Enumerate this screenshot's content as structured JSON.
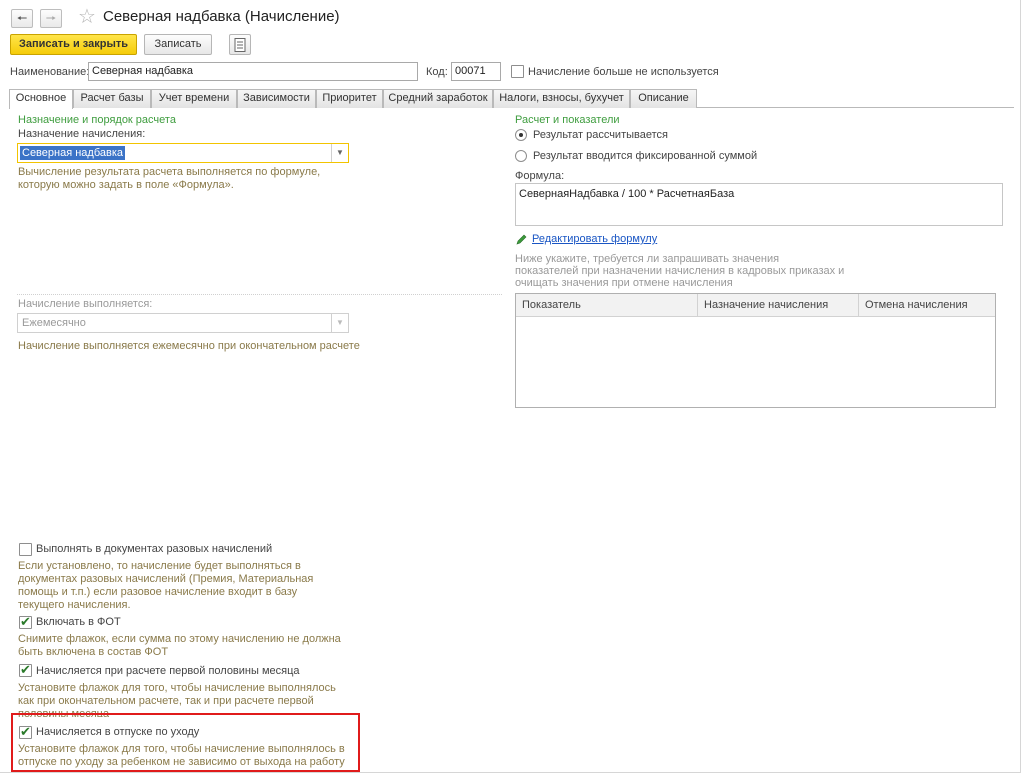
{
  "window": {
    "title": "Северная надбавка (Начисление)",
    "back_icon": "arrow-left-icon",
    "forward_icon": "arrow-right-icon",
    "favorite_icon": "star-icon"
  },
  "toolbar": {
    "save_close_label": "Записать и закрыть",
    "save_label": "Записать",
    "report_icon": "document-list-icon"
  },
  "header": {
    "name_label": "Наименование:",
    "name_value": "Северная надбавка",
    "code_label": "Код:",
    "code_value": "00071",
    "not_used_label": "Начисление больше не используется"
  },
  "tabs": [
    {
      "label": "Основное"
    },
    {
      "label": "Расчет базы"
    },
    {
      "label": "Учет времени"
    },
    {
      "label": "Зависимости"
    },
    {
      "label": "Приоритет"
    },
    {
      "label": "Средний заработок"
    },
    {
      "label": "Налоги, взносы, бухучет"
    },
    {
      "label": "Описание"
    }
  ],
  "left": {
    "section_title": "Назначение и порядок расчета",
    "purpose_label": "Назначение начисления:",
    "purpose_value": "Северная надбавка",
    "purpose_hint_1": "Вычисление результата расчета выполняется по формуле,",
    "purpose_hint_2": "которую можно задать в поле «Формула».",
    "period_label": "Начисление выполняется:",
    "period_value": "Ежемесячно",
    "period_hint": "Начисление выполняется ежемесячно при окончательном расчете",
    "one_time": {
      "label": "Выполнять в документах разовых начислений",
      "hint": [
        "Если установлено, то начисление будет выполняться в",
        "документах разовых начислений (Премия, Материальная",
        "помощь и т.п.) если разовое начисление входит в базу",
        "текущего начисления."
      ]
    },
    "fot": {
      "label": "Включать в ФОТ",
      "hint": [
        "Снимите флажок, если сумма по этому начислению не должна",
        "быть включена в состав ФОТ"
      ]
    },
    "first_half": {
      "label": "Начисляется при расчете первой половины месяца",
      "hint": [
        "Установите флажок для того, чтобы начисление выполнялось",
        "как при окончательном расчете, так и при расчете первой",
        "половины месяца"
      ]
    },
    "childcare": {
      "label": "Начисляется в отпуске по уходу",
      "hint": [
        "Установите флажок для того, чтобы начисление выполнялось в",
        "отпуске по уходу за ребенком не зависимо от выхода на работу"
      ]
    }
  },
  "right": {
    "section_title": "Расчет и показатели",
    "radio_calc": "Результат рассчитывается",
    "radio_fixed": "Результат вводится фиксированной суммой",
    "formula_label": "Формула:",
    "formula_value": "СевернаяНадбавка / 100 * РасчетнаяБаза",
    "edit_link": "Редактировать формулу",
    "edit_icon": "pencil-icon",
    "indicators_hint": [
      "Ниже укажите, требуется ли запрашивать значения",
      "показателей при назначении начисления в кадровых приказах и",
      "очищать значения при отмене начисления"
    ],
    "table": {
      "columns": [
        "Показатель",
        "Назначение начисления",
        "Отмена начисления"
      ],
      "rows": []
    }
  }
}
